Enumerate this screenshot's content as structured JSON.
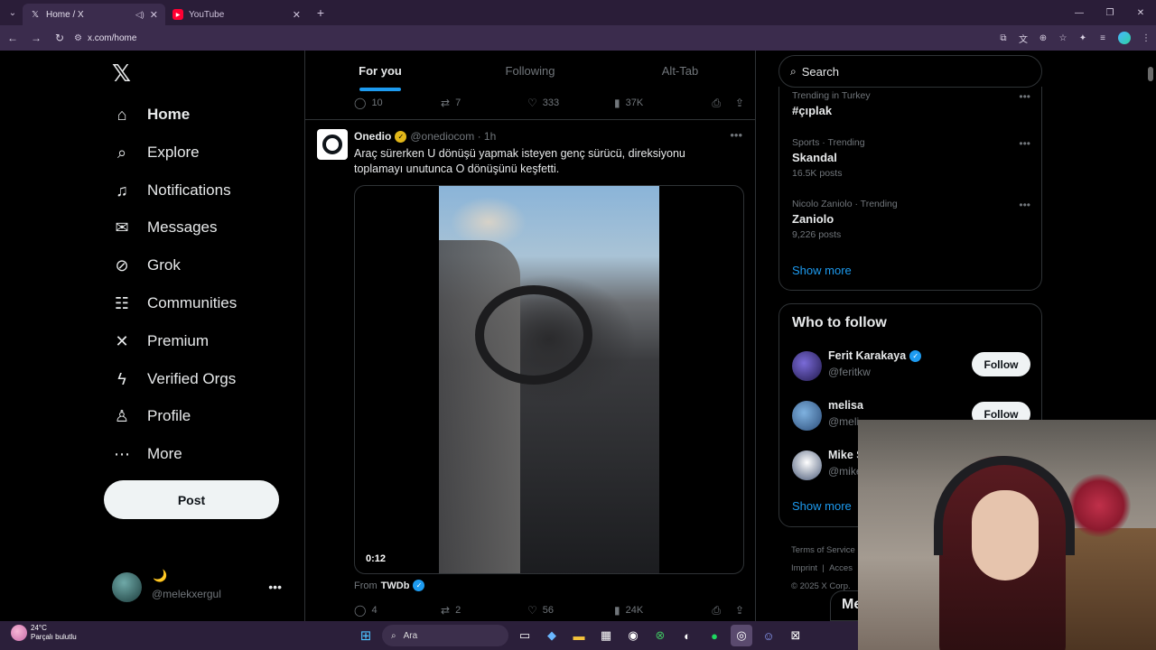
{
  "browser": {
    "tabs": [
      {
        "title": "Home / X",
        "favicon": "x-logo-icon",
        "active": true
      },
      {
        "title": "YouTube",
        "favicon": "youtube-icon",
        "active": false
      }
    ],
    "url": "x.com/home"
  },
  "nav": {
    "items": [
      {
        "label": "Home",
        "icon": "home-icon",
        "glyph": "⌂"
      },
      {
        "label": "Explore",
        "icon": "search-icon",
        "glyph": "⌕"
      },
      {
        "label": "Notifications",
        "icon": "bell-icon",
        "glyph": "🔔"
      },
      {
        "label": "Messages",
        "icon": "mail-icon",
        "glyph": "✉"
      },
      {
        "label": "Grok",
        "icon": "grok-icon",
        "glyph": "⊘"
      },
      {
        "label": "Communities",
        "icon": "people-icon",
        "glyph": "👥"
      },
      {
        "label": "Premium",
        "icon": "x-icon",
        "glyph": "𝕏"
      },
      {
        "label": "Verified Orgs",
        "icon": "lightning-icon",
        "glyph": "ϟ"
      },
      {
        "label": "Profile",
        "icon": "person-icon",
        "glyph": "👤"
      },
      {
        "label": "More",
        "icon": "more-circle-icon",
        "glyph": "⋯"
      }
    ],
    "post_label": "Post",
    "account": {
      "display_name": "🌙",
      "handle": "@melekxergul"
    }
  },
  "feed": {
    "tabs": [
      "For you",
      "Following",
      "Alt-Tab"
    ],
    "prev_actions": {
      "replies": "10",
      "reposts": "7",
      "likes": "333",
      "views": "37K"
    },
    "tweet": {
      "name": "Onedio",
      "handle": "@onediocom",
      "time": "1h",
      "text": "Araç sürerken U dönüşü yapmak isteyen genç sürücü, direksiyonu toplamayı unutunca O dönüşünü keşfetti.",
      "video_time": "0:12",
      "from_label": "From",
      "from_source": "TWDb",
      "actions": {
        "replies": "4",
        "reposts": "2",
        "likes": "56",
        "views": "24K"
      }
    }
  },
  "sidebar": {
    "search_placeholder": "Search",
    "trends": [
      {
        "meta": "Trending in Turkey",
        "title": "#çıplak",
        "count": ""
      },
      {
        "meta": "Sports · Trending",
        "title": "Skandal",
        "count": "16.5K posts"
      },
      {
        "meta": "Nicolo Zaniolo · Trending",
        "title": "Zaniolo",
        "count": "9,226 posts"
      }
    ],
    "show_more": "Show more",
    "who_title": "Who to follow",
    "who": [
      {
        "name": "Ferit Karakaya",
        "handle": "@feritkw",
        "verified": true
      },
      {
        "name": "melisa",
        "handle": "@meli",
        "verified": false
      },
      {
        "name": "Mike S",
        "handle": "@mike",
        "verified": false
      }
    ],
    "follow_label": "Follow",
    "footer": {
      "terms": "Terms of Service",
      "imprint": "Imprint",
      "pipe": "|",
      "access": "Acces",
      "copyright": "© 2025 X Corp."
    },
    "messages_stub": "Me"
  },
  "taskbar": {
    "temp": "24°C",
    "weather": "Parçalı bulutlu",
    "search": "Ara"
  }
}
